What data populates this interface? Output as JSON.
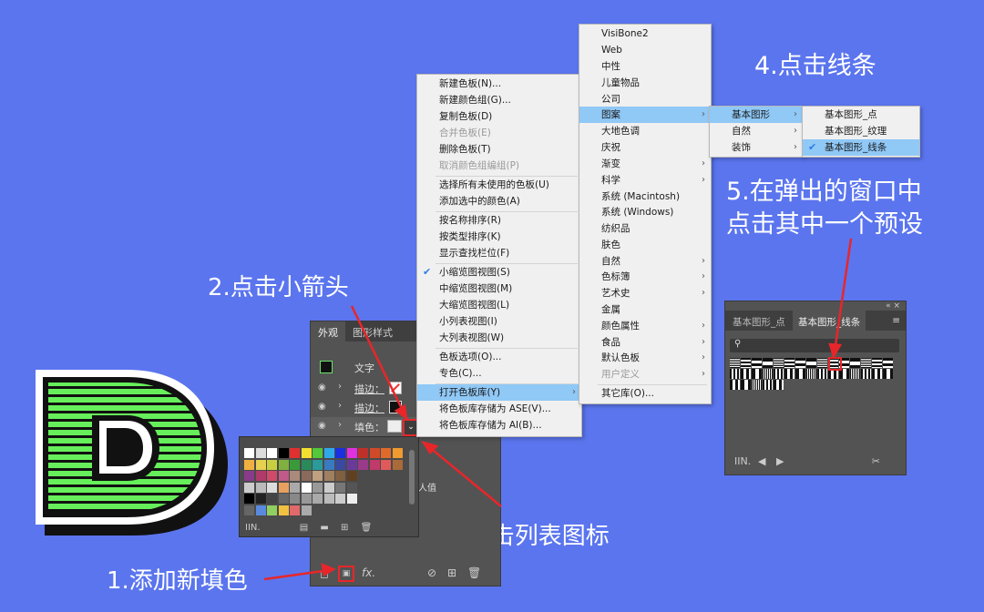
{
  "steps": {
    "s1": "1.添加新填色",
    "s2": "2.点击小箭头",
    "s3": "3.点击列表图标",
    "s4": "4.点击线条",
    "s5_line1": "5.在弹出的窗口中",
    "s5_line2": "点击其中一个预设"
  },
  "appearance_panel": {
    "tabs": [
      "外观",
      "图形样式"
    ],
    "rows": {
      "text": "文字",
      "stroke1": "描边：",
      "stroke2": "描边：",
      "fill": "填色："
    },
    "partial_text": "人值",
    "bottom_icons": [
      "add-stroke-icon",
      "add-fill-icon",
      "fx-icon",
      "clear-icon",
      "duplicate-icon",
      "trash-icon"
    ],
    "fx_label": "fx."
  },
  "swatch_popup": {
    "icons": [
      "library-icon",
      "list-view-icon",
      "folder-icon",
      "new-swatch-icon",
      "trash-icon"
    ]
  },
  "swatch_menu": {
    "items": [
      "新建色板(N)...",
      "新建颜色组(G)...",
      "复制色板(D)",
      "合并色板(E)",
      "删除色板(T)",
      "取消颜色组编组(P)",
      "选择所有未使用的色板(U)",
      "添加选中的颜色(A)",
      "按名称排序(R)",
      "按类型排序(K)",
      "显示查找栏位(F)",
      "小缩览图视图(S)",
      "中缩览图视图(M)",
      "大缩览图视图(L)",
      "小列表视图(I)",
      "大列表视图(W)",
      "色板选项(O)...",
      "专色(C)...",
      "打开色板库(Y)",
      "将色板库存储为 ASE(V)...",
      "将色板库存储为 AI(B)..."
    ]
  },
  "library_menu": {
    "items": [
      "VisiBone2",
      "Web",
      "中性",
      "儿童物品",
      "公司",
      "图案",
      "大地色调",
      "庆祝",
      "渐变",
      "科学",
      "系统 (Macintosh)",
      "系统 (Windows)",
      "纺织品",
      "肤色",
      "自然",
      "色标簿",
      "艺术史",
      "金属",
      "颜色属性",
      "食品",
      "默认色板",
      "用户定义",
      "其它库(O)..."
    ]
  },
  "pattern_menu": {
    "items": [
      "基本图形",
      "自然",
      "装饰"
    ]
  },
  "shapes_menu": {
    "items": [
      "基本图形_点",
      "基本图形_纹理",
      "基本图形_线条"
    ]
  },
  "library_panel": {
    "tabs": [
      "基本图形_点",
      "基本图形_线条"
    ]
  },
  "colors": {
    "background": "#5b75ee",
    "highlight": "#90c8f6",
    "annotation_red": "#e8262a",
    "d_green": "#66ef5a"
  }
}
